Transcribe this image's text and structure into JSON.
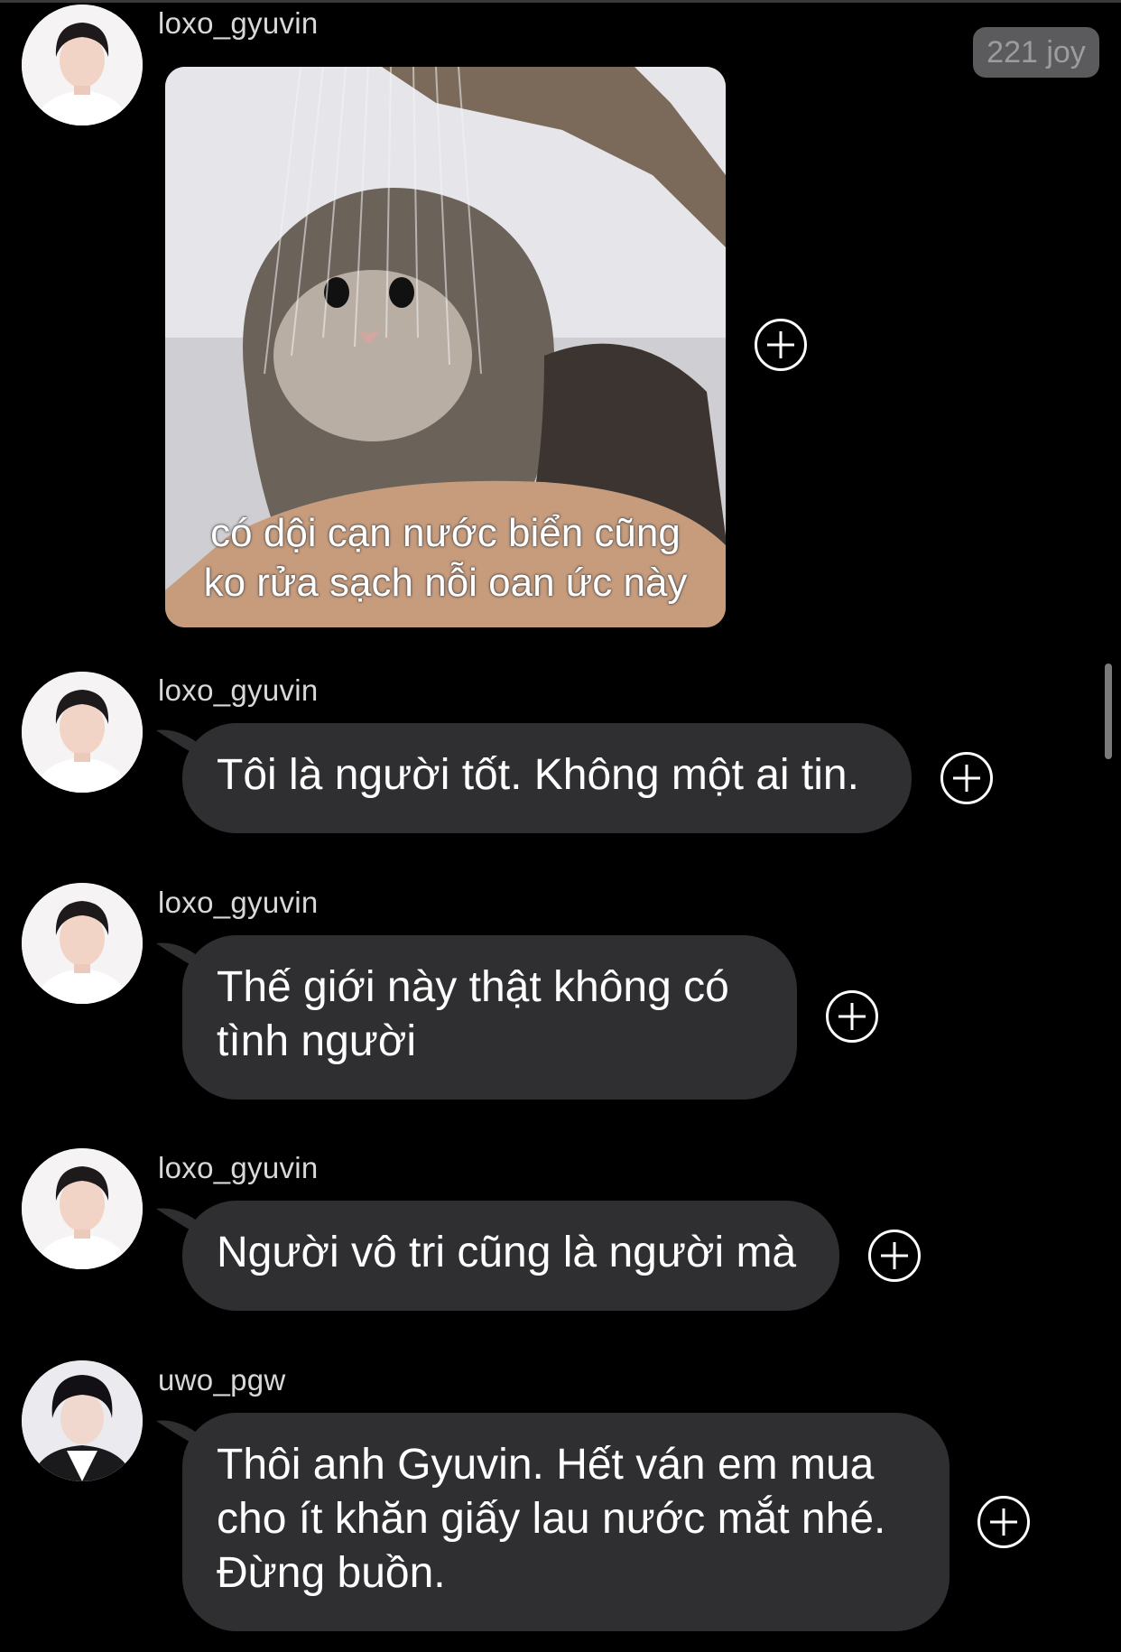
{
  "badge": {
    "label": "221 joy"
  },
  "messages": [
    {
      "user": "loxo_gyuvin",
      "type": "image",
      "image_caption": [
        "có dội cạn nước biển cũng",
        "ko rửa sạch nỗi oan ức này"
      ]
    },
    {
      "user": "loxo_gyuvin",
      "type": "text",
      "lines": [
        "Tôi là người tốt. Không một ai tin."
      ]
    },
    {
      "user": "loxo_gyuvin",
      "type": "text",
      "lines": [
        "Thế giới này thật không có",
        "tình người"
      ]
    },
    {
      "user": "loxo_gyuvin",
      "type": "text",
      "lines": [
        "Người vô tri cũng là người mà"
      ]
    },
    {
      "user": "uwo_pgw",
      "type": "text",
      "lines": [
        "Thôi anh Gyuvin. Hết ván em mua",
        "cho ít khăn giấy lau nước mắt nhé.",
        "Đừng buồn."
      ]
    }
  ],
  "icons": {
    "react": "add-reaction-icon"
  },
  "colors": {
    "background": "#000000",
    "bubble": "#2f2f31",
    "username": "#d8d8d8",
    "badge_bg": "#5b5b5d"
  }
}
